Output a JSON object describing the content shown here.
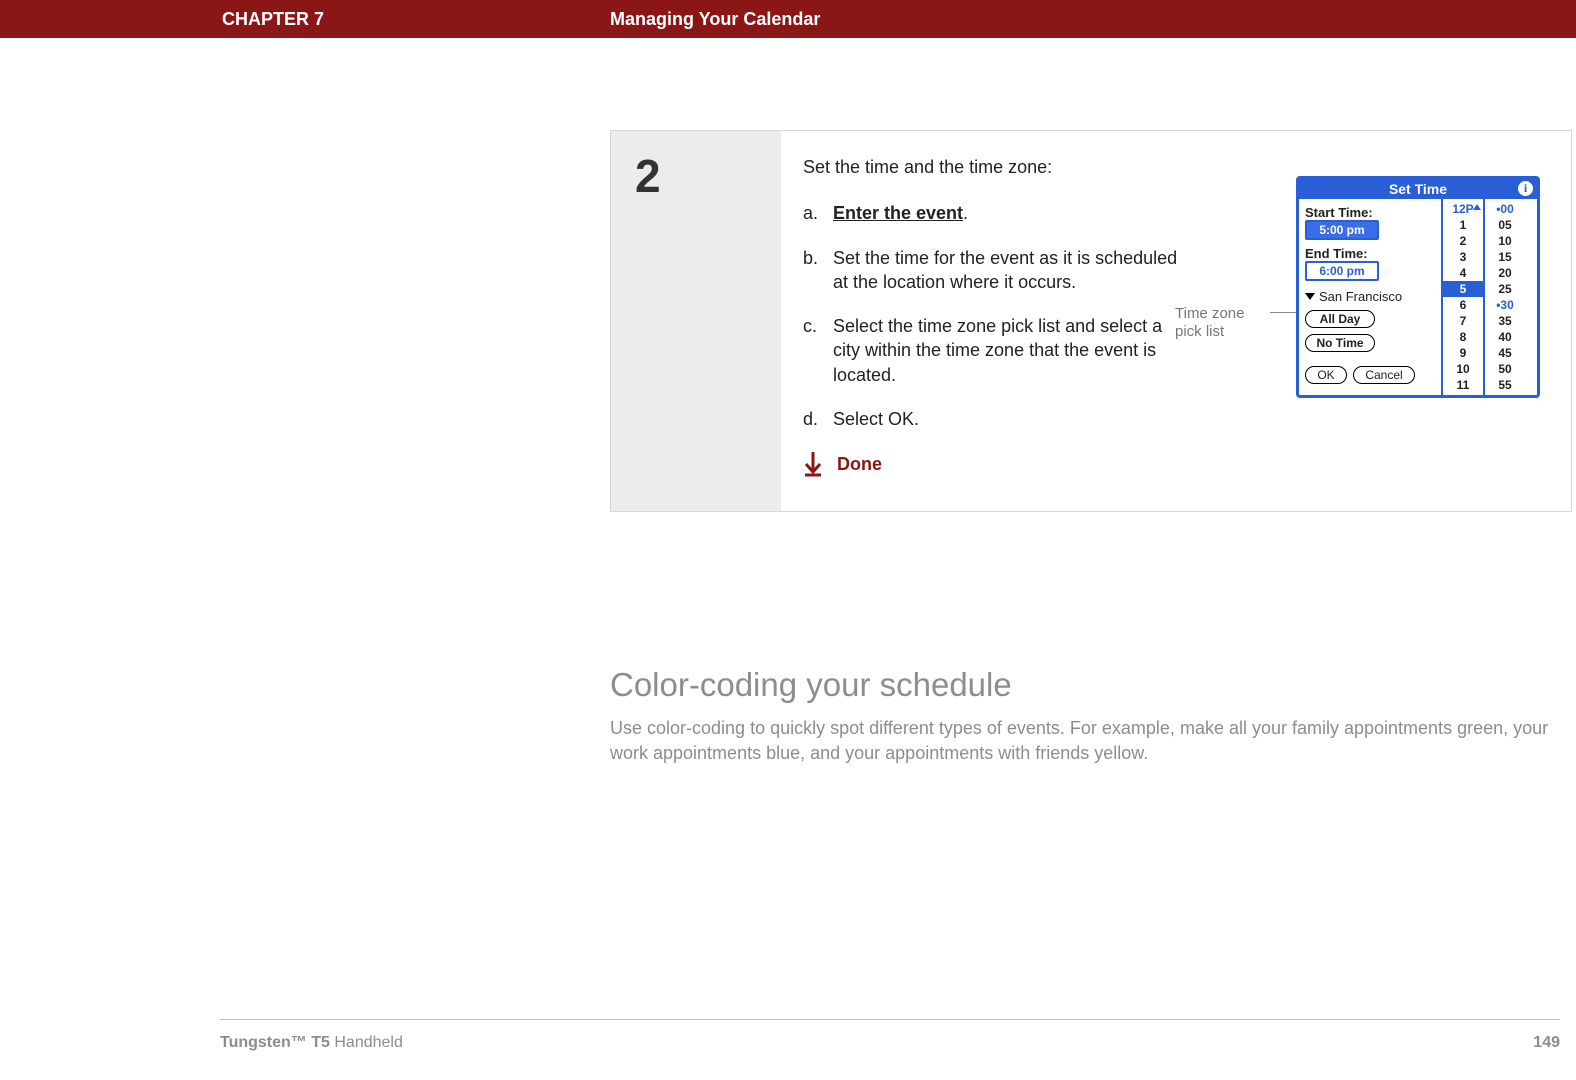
{
  "header": {
    "chapter": "CHAPTER 7",
    "title": "Managing Your Calendar"
  },
  "step": {
    "number": "2",
    "intro": "Set the time and the time zone:",
    "items": [
      {
        "label": "a.",
        "text_plain": "Enter the event",
        "suffix": ".",
        "bold_underline": true
      },
      {
        "label": "b.",
        "text_plain": "Set the time for the event as it is scheduled at the location where it occurs."
      },
      {
        "label": "c.",
        "text_plain": "Select the time zone pick list and select a city within the time zone that the event is located."
      },
      {
        "label": "d.",
        "text_plain": "Select OK."
      }
    ],
    "done": "Done"
  },
  "callout": {
    "line1": "Time zone",
    "line2": "pick list"
  },
  "device": {
    "title": "Set Time",
    "start_label": "Start Time:",
    "start_value": "5:00 pm",
    "end_label": "End Time:",
    "end_value": "6:00 pm",
    "timezone": "San Francisco",
    "allday": "All Day",
    "notime": "No Time",
    "ok": "OK",
    "cancel": "Cancel",
    "hours": [
      "12P",
      "1",
      "2",
      "3",
      "4",
      "5",
      "6",
      "7",
      "8",
      "9",
      "10",
      "11"
    ],
    "selected_hour": "5",
    "minutes": [
      "00",
      "05",
      "10",
      "15",
      "20",
      "25",
      "30",
      "35",
      "40",
      "45",
      "50",
      "55"
    ],
    "minute_anchors": [
      "00",
      "30"
    ]
  },
  "section": {
    "heading": "Color-coding your schedule",
    "body": "Use color-coding to quickly spot different types of events. For example, make all your family appointments green, your work appointments blue, and your appointments with friends yellow."
  },
  "footer": {
    "product_bold": "Tungsten™ T5",
    "product_rest": " Handheld",
    "page": "149"
  }
}
